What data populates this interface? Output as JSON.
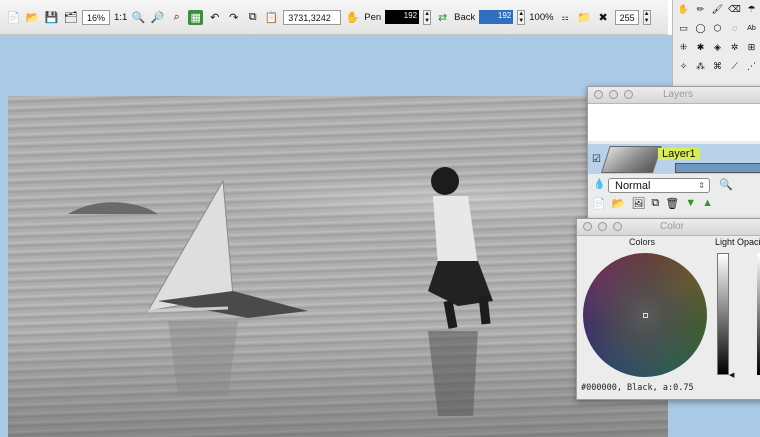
{
  "toolbar": {
    "zoom_percent": "16%",
    "actual_size": "1:1",
    "coordinates": "3731,3242",
    "pen_label": "Pen",
    "pen_color": "#000000",
    "pen_size": "192",
    "back_label": "Back",
    "back_color": "#2e6fbf",
    "back_size": "192",
    "opacity_percent": "100%",
    "tolerance": "255"
  },
  "layers_panel": {
    "title": "Layers",
    "layer_name": "Layer1",
    "blend_mode": "Normal"
  },
  "color_panel": {
    "title": "Color",
    "colors_label": "Colors",
    "light_label": "Light",
    "opacity_label": "Opaci",
    "readout": "#000000, Black, a:0.75"
  },
  "colors": {
    "canvas_bg": "#a9c9e4",
    "selection_blue": "#b9d2ea",
    "layer_name_highlight": "#d8ee55"
  }
}
